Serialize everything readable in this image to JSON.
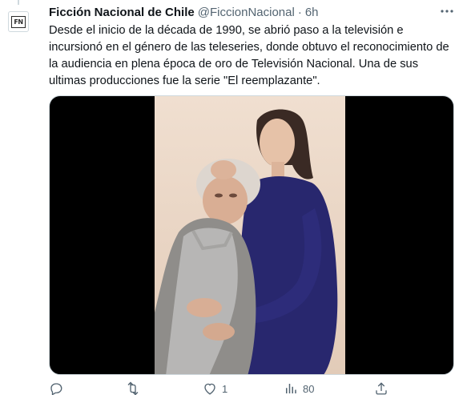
{
  "author": {
    "display_name": "Ficción Nacional de Chile",
    "handle": "@FiccionNacional",
    "separator": "·",
    "time": "6h",
    "avatar_text": "FN"
  },
  "tweet": {
    "text": "Desde el inicio de la década de 1990, se abrió paso a la televisión e incursionó en el género de las teleseries, donde obtuvo el reconocimiento de la audiencia en plena época de oro de Televisión Nacional. Una de sus ultimas producciones fue la serie \"El reemplazante\"."
  },
  "actions": {
    "reply_count": "",
    "retweet_count": "",
    "like_count": "1",
    "views_count": "80"
  },
  "icons": {
    "more": "more-icon",
    "reply": "reply-icon",
    "retweet": "retweet-icon",
    "like": "heart-icon",
    "views": "views-icon",
    "share": "share-icon"
  },
  "colors": {
    "text": "#0f1419",
    "secondary": "#536471",
    "border": "#cfd9de"
  }
}
